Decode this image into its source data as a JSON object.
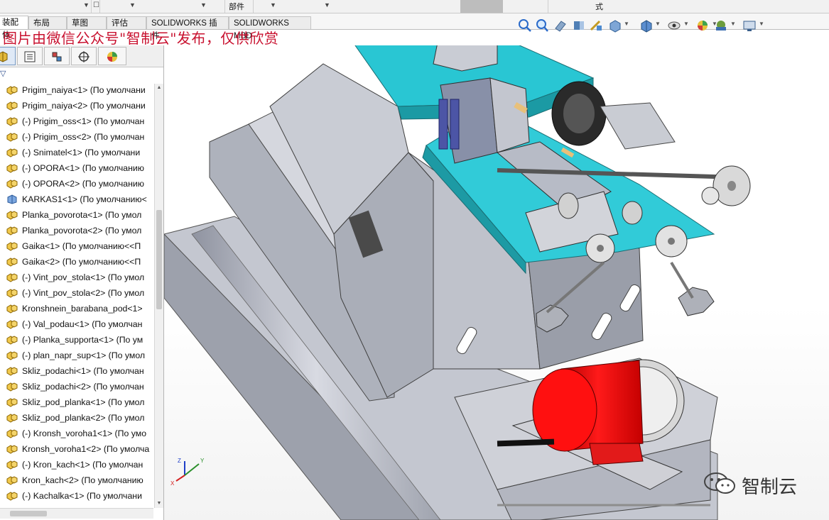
{
  "menu": {
    "assembly_label": "部件",
    "style_label": "式"
  },
  "tabs": [
    {
      "label": "装配体"
    },
    {
      "label": "布局"
    },
    {
      "label": "草图"
    },
    {
      "label": "评估"
    },
    {
      "label": "SOLIDWORKS 插件"
    },
    {
      "label": "SOLIDWORKS MBD"
    }
  ],
  "watermark": "图片由微信公众号\"智制云\"发布，仅供欣赏",
  "toolbar_icons": [
    "zoom-to-fit-icon",
    "zoom-area-icon",
    "previous-view-icon",
    "section-view-icon",
    "dynamic-annotation-icon",
    "view-orientation-icon",
    "display-style-icon",
    "hide-show-icon",
    "edit-appearance-icon",
    "apply-scene-icon",
    "view-settings-icon"
  ],
  "feature_tree": [
    {
      "label": "Prigim_naiya<1> (По умолчани"
    },
    {
      "label": "Prigim_naiya<2> (По умолчани"
    },
    {
      "label": "(-) Prigim_oss<1> (По умолчан"
    },
    {
      "label": "(-) Prigim_oss<2> (По умолчан"
    },
    {
      "label": "(-) Snimatel<1> (По умолчани"
    },
    {
      "label": "(-) OPORA<1> (По умолчанию"
    },
    {
      "label": "(-) OPORA<2> (По умолчанию"
    },
    {
      "label": "KARKAS1<1> (По умолчанию<"
    },
    {
      "label": "Planka_povorota<1> (По умол"
    },
    {
      "label": "Planka_povorota<2> (По умол"
    },
    {
      "label": "Gaika<1> (По умолчанию<<П"
    },
    {
      "label": "Gaika<2> (По умолчанию<<П"
    },
    {
      "label": "(-) Vint_pov_stola<1> (По умол"
    },
    {
      "label": "(-) Vint_pov_stola<2> (По умол"
    },
    {
      "label": "Kronshnein_barabana_pod<1>"
    },
    {
      "label": "(-) Val_podau<1> (По умолчан"
    },
    {
      "label": "(-) Planka_supporta<1> (По ум"
    },
    {
      "label": "(-) plan_napr_sup<1> (По умол"
    },
    {
      "label": "Skliz_podachi<1> (По умолчан"
    },
    {
      "label": "Skliz_podachi<2> (По умолчан"
    },
    {
      "label": "Skliz_pod_planka<1> (По умол"
    },
    {
      "label": "Skliz_pod_planka<2> (По умол"
    },
    {
      "label": "(-) Kronsh_voroha1<1> (По умо"
    },
    {
      "label": "Kronsh_voroha1<2> (По умолча"
    },
    {
      "label": "(-) Kron_kach<1> (По умолчан"
    },
    {
      "label": "Kron_kach<2> (По умолчанию"
    },
    {
      "label": "(-) Kachalka<1> (По умолчани"
    }
  ],
  "triad": {
    "x": "X",
    "y": "Y",
    "z": "Z"
  },
  "brand_text": "智制云",
  "colors": {
    "base_gray": "#b9bcc6",
    "frame_gray": "#c8cad3",
    "table_cyan": "#2ecbd6",
    "motor_red": "#f20f0f",
    "watermark_red": "#c8102e"
  }
}
